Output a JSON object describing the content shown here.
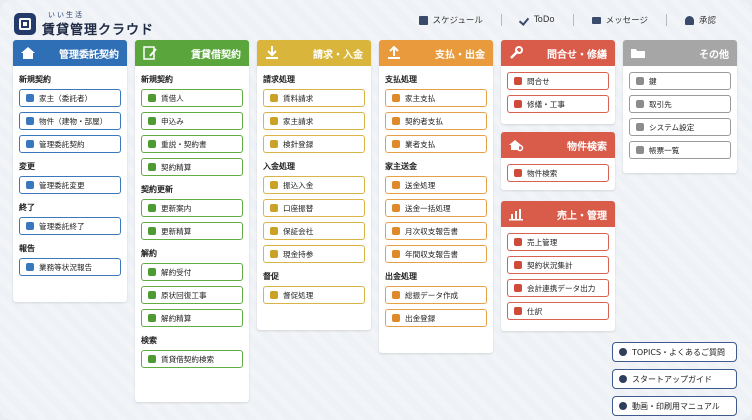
{
  "app": {
    "logo_ruby": "いい生活",
    "logo_name": "賃貸管理クラウド"
  },
  "topnav": [
    {
      "label": "スケジュール",
      "icon": "calendar-icon"
    },
    {
      "label": "ToDo",
      "icon": "check-icon"
    },
    {
      "label": "メッセージ",
      "icon": "mail-icon"
    },
    {
      "label": "承認",
      "icon": "person-stamp-icon"
    }
  ],
  "colors": {
    "blue": "#2f6fb5",
    "green": "#5aa53c",
    "yellow": "#d9b53c",
    "orange": "#e89a3c",
    "red": "#d95b4a",
    "gray": "#a6a6a6"
  },
  "panels": {
    "kanri": {
      "title": "管理委託契約",
      "sections": [
        {
          "title": "新規契約",
          "items": [
            "家主（委託者）",
            "物件（建物・部屋）",
            "管理委託契約"
          ]
        },
        {
          "title": "変更",
          "items": [
            "管理委託変更"
          ]
        },
        {
          "title": "終了",
          "items": [
            "管理委託終了"
          ]
        },
        {
          "title": "報告",
          "items": [
            "業務等状況報告"
          ]
        }
      ]
    },
    "chintai": {
      "title": "賃貸借契約",
      "sections": [
        {
          "title": "新規契約",
          "items": [
            "賃借人",
            "申込み",
            "重説・契約書",
            "契約精算"
          ]
        },
        {
          "title": "契約更新",
          "items": [
            "更新案内",
            "更新精算"
          ]
        },
        {
          "title": "解約",
          "items": [
            "解約受付",
            "原状回復工事",
            "解約精算"
          ]
        },
        {
          "title": "検索",
          "items": [
            "賃貸借契約検索"
          ]
        }
      ]
    },
    "seikyu": {
      "title": "請求・入金",
      "sections": [
        {
          "title": "請求処理",
          "items": [
            "賃料請求",
            "家主請求",
            "検針登録"
          ]
        },
        {
          "title": "入金処理",
          "items": [
            "振込入金",
            "口座振替",
            "保証会社",
            "現金持参"
          ]
        },
        {
          "title": "督促",
          "items": [
            "督促処理"
          ]
        }
      ]
    },
    "shiharai": {
      "title": "支払・出金",
      "sections": [
        {
          "title": "支払処理",
          "items": [
            "家主支払",
            "契約者支払",
            "業者支払"
          ]
        },
        {
          "title": "家主送金",
          "items": [
            "送金処理",
            "送金一括処理",
            "月次収支報告書",
            "年間収支報告書"
          ]
        },
        {
          "title": "出金処理",
          "items": [
            "総振データ作成",
            "出金登録"
          ]
        }
      ]
    },
    "toiawase": {
      "title": "問合せ・修繕",
      "items": [
        "問合せ",
        "修繕・工事"
      ]
    },
    "bukken": {
      "title": "物件検索",
      "items": [
        "物件検索"
      ]
    },
    "uriage": {
      "title": "売上・管理",
      "items": [
        "売上管理",
        "契約状況集計",
        "会計連携データ出力",
        "仕訳"
      ]
    },
    "sonota": {
      "title": "その他",
      "items": [
        "鍵",
        "取引先",
        "システム設定",
        "帳票一覧"
      ]
    }
  },
  "side_links": [
    "TOPICS・よくあるご質問",
    "スタートアップガイド",
    "動画・印刷用マニュアル"
  ]
}
